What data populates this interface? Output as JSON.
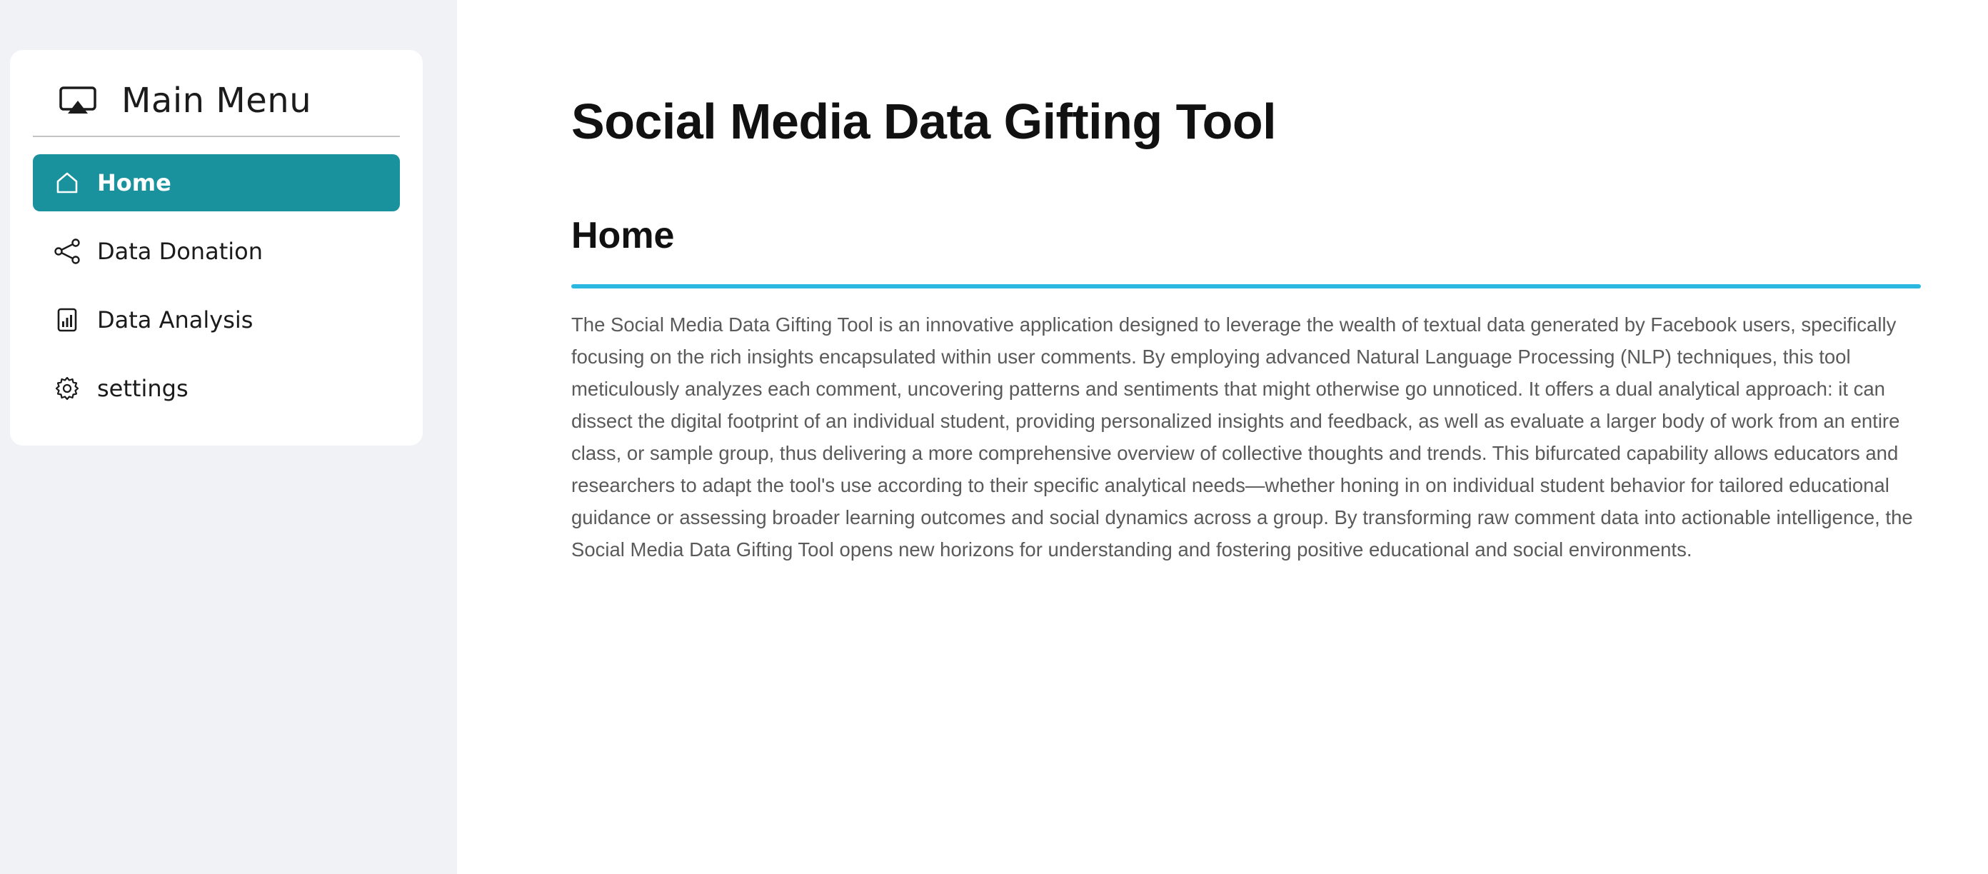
{
  "sidebar": {
    "title": "Main Menu",
    "header_icon": "airplay-icon",
    "items": [
      {
        "label": "Home",
        "icon": "home-icon",
        "active": true
      },
      {
        "label": "Data Donation",
        "icon": "share-icon",
        "active": false
      },
      {
        "label": "Data Analysis",
        "icon": "bar-chart-document-icon",
        "active": false
      },
      {
        "label": "settings",
        "icon": "gear-icon",
        "active": false
      }
    ]
  },
  "main": {
    "page_title": "Social Media Data Gifting Tool",
    "section_title": "Home",
    "body": "The Social Media Data Gifting Tool is an innovative application designed to leverage the wealth of textual data generated by Facebook users, specifically focusing on the rich insights encapsulated within user comments. By employing advanced Natural Language Processing (NLP) techniques, this tool meticulously analyzes each comment, uncovering patterns and sentiments that might otherwise go unnoticed. It offers a dual analytical approach: it can dissect the digital footprint of an individual student, providing personalized insights and feedback, as well as evaluate a larger body of work from an entire class, or sample group, thus delivering a more comprehensive overview of collective thoughts and trends. This bifurcated capability allows educators and researchers to adapt the tool's use according to their specific analytical needs—whether honing in on individual student behavior for tailored educational guidance or assessing broader learning outcomes and social dynamics across a group. By transforming raw comment data into actionable intelligence, the Social Media Data Gifting Tool opens new horizons for understanding and fostering positive educational and social environments."
  },
  "colors": {
    "sidebar_bg": "#f0f2f6",
    "active_item_bg": "#19929e",
    "section_rule": "#2bb8e0",
    "body_text": "#5a5a5a"
  }
}
